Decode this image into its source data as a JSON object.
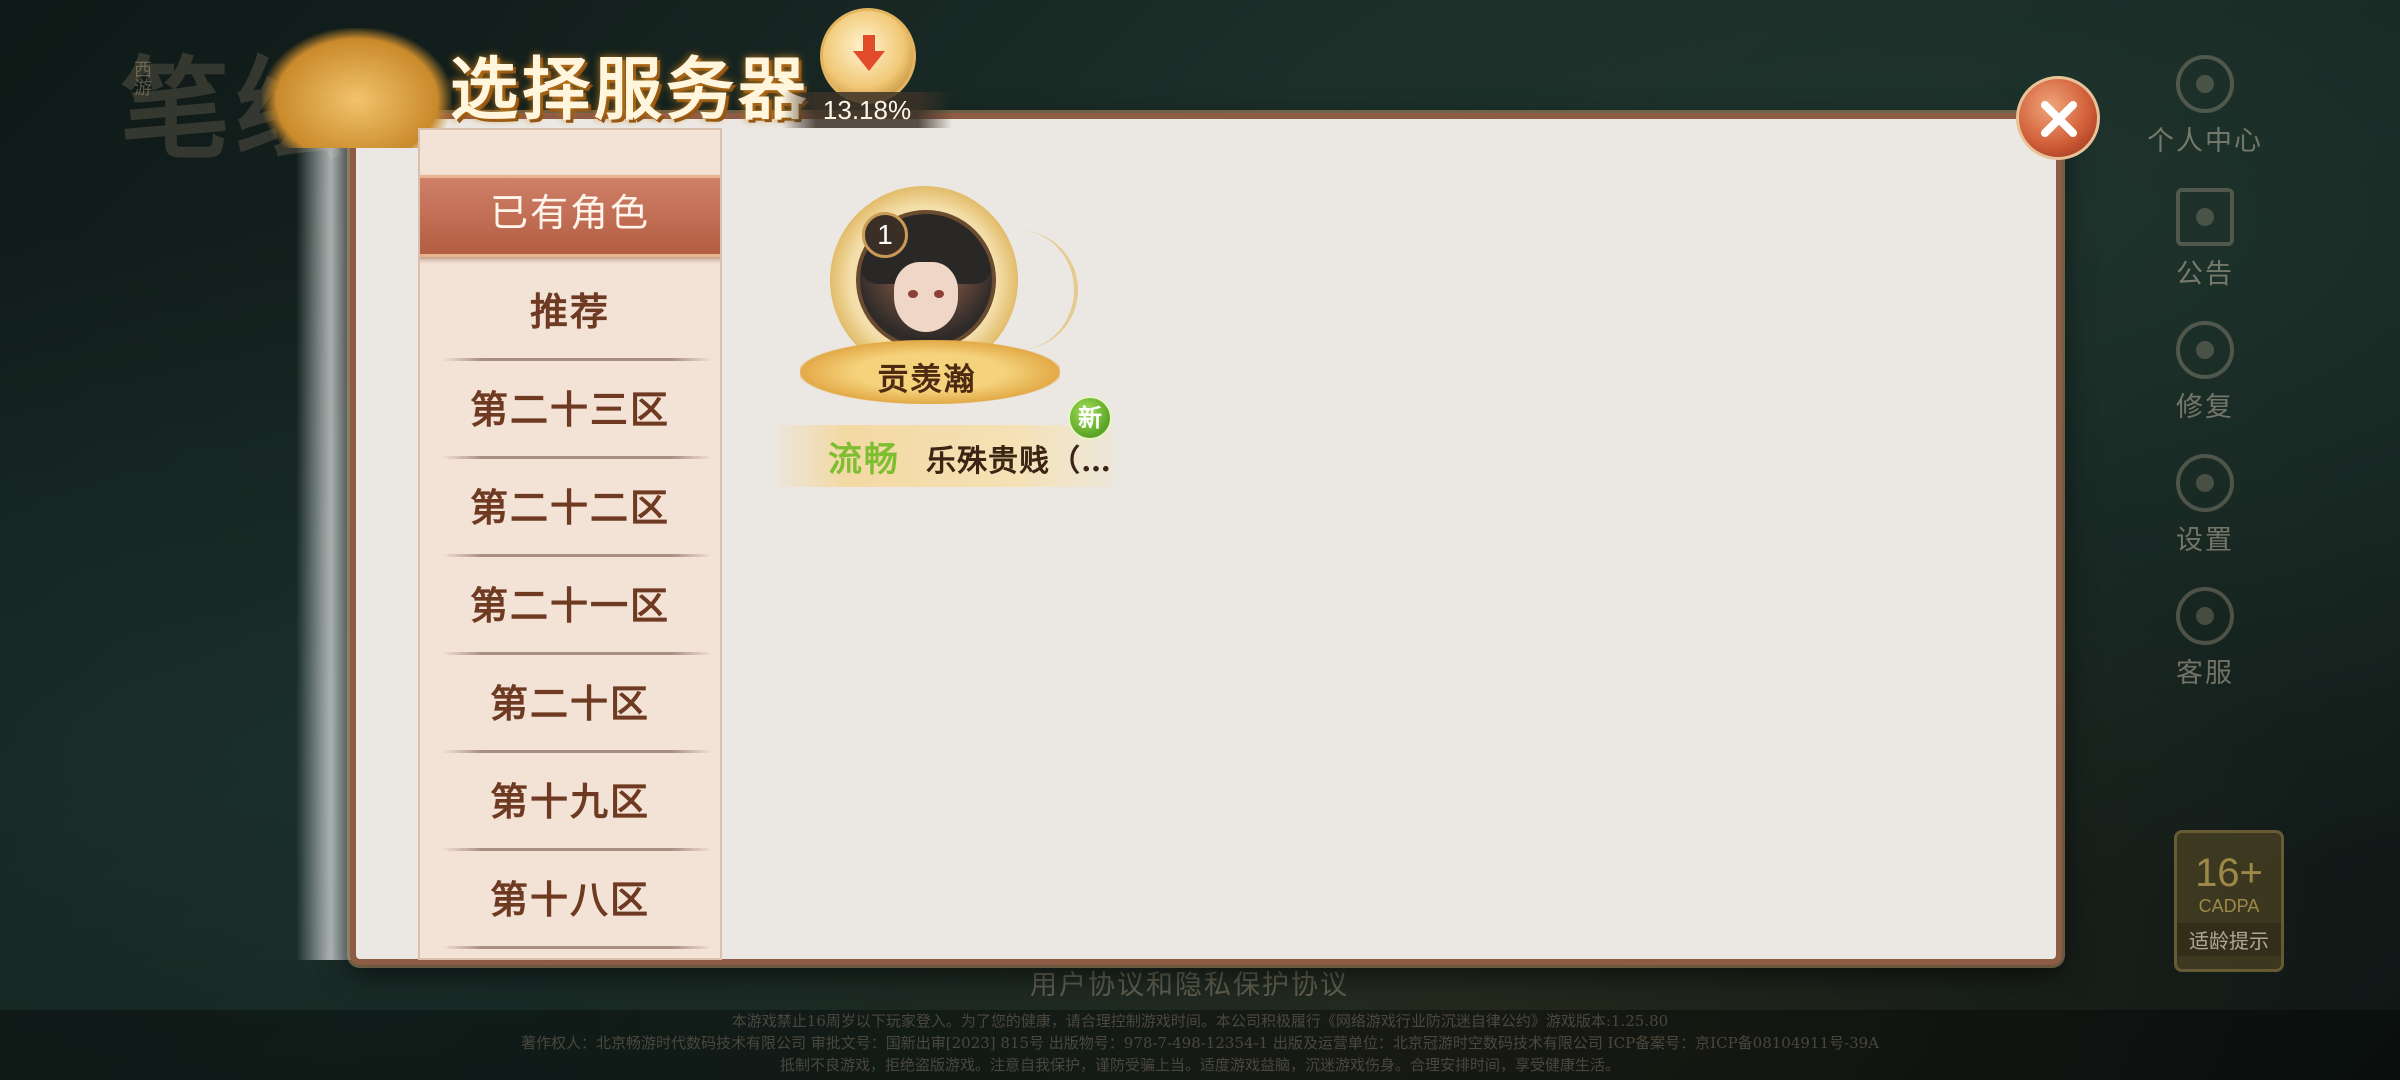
{
  "background": {
    "logo_text": "笔绘",
    "logo_small": "西游"
  },
  "header": {
    "title": "选择服务器",
    "download_percent": "13.18%"
  },
  "side_menu": [
    {
      "label": "个人中心",
      "icon": "user-center-icon"
    },
    {
      "label": "公告",
      "icon": "announcement-icon"
    },
    {
      "label": "修复",
      "icon": "repair-icon"
    },
    {
      "label": "设置",
      "icon": "settings-gear-icon"
    },
    {
      "label": "客服",
      "icon": "customer-service-icon"
    }
  ],
  "age_rating": {
    "age": "16+",
    "org": "CADPA",
    "tip": "适龄提示"
  },
  "server_list": [
    {
      "label": "已有角色",
      "active": true
    },
    {
      "label": "推荐"
    },
    {
      "label": "第二十三区"
    },
    {
      "label": "第二十二区"
    },
    {
      "label": "第二十一区"
    },
    {
      "label": "第二十区"
    },
    {
      "label": "第十九区"
    },
    {
      "label": "第十八区"
    }
  ],
  "character": {
    "level": "1",
    "name": "贡羡瀚",
    "status": "流畅",
    "server": "乐殊贵贱（…",
    "new_badge": "新"
  },
  "footer": {
    "agreement": "用户协议和隐私保护协议",
    "line1": "本游戏禁止16周岁以下玩家登入。为了您的健康，请合理控制游戏时间。本公司积极履行《网络游戏行业防沉迷自律公约》游戏版本:1.25.80",
    "line2": "著作权人：北京畅游时代数码技术有限公司 审批文号：国新出审[2023] 815号 出版物号：978-7-498-12354-1 出版及运营单位：北京冠游时空数码技术有限公司 ICP备案号：京ICP备08104911号-39A",
    "line3": "抵制不良游戏，拒绝盗版游戏。注意自我保护，谨防受骗上当。适度游戏益脑，沉迷游戏伤身。合理安排时间，享受健康生活。"
  },
  "colors": {
    "panel_bg": "#ebe8e3",
    "panel_border": "#8e5b44",
    "active_tab": "#b35d42",
    "server_text": "#6f3a22",
    "status_green": "#7ebe31"
  }
}
